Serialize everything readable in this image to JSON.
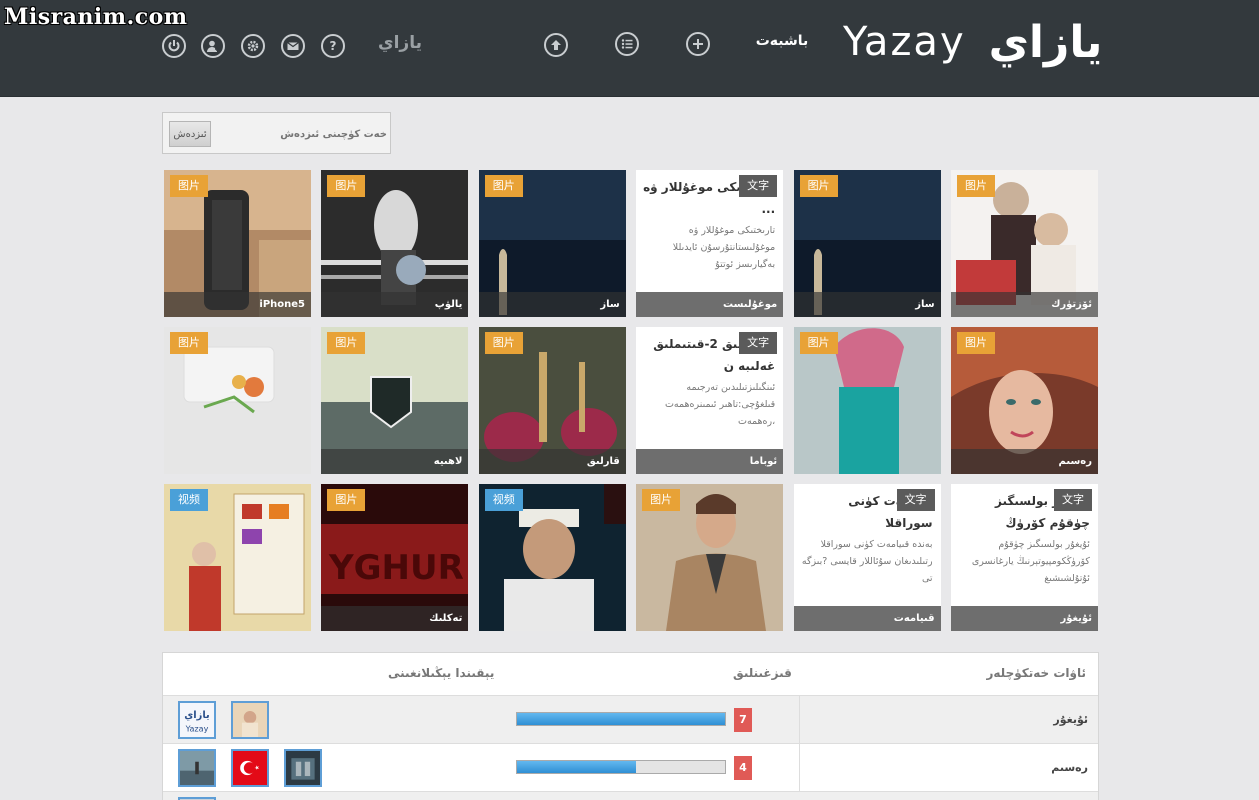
{
  "watermark": "Misranim.com",
  "header": {
    "user_label": "يازاي",
    "home_label": "باشبەت",
    "logo_latin": "Yazay",
    "logo_arabic": "يازاي"
  },
  "search": {
    "button_label": "ئىزدەش",
    "placeholder": "خەت كۈچىنى ئىزدەش"
  },
  "tiles": [
    {
      "type": "image",
      "badge": "图片",
      "caption": "iPhone5"
    },
    {
      "type": "image",
      "badge": "图片",
      "caption": "يالۋپ"
    },
    {
      "type": "image",
      "badge": "图片",
      "caption": "ساز"
    },
    {
      "type": "text",
      "badge": "文字",
      "title": "تارىختىكى موغۇللار ۋە ...",
      "body": "تارىختىكى موغۇللار ۋە موغۇلىستانتۇرسۇن ئايدىللا بەگيارىسز ئوتتۇ",
      "caption": "موغۇلىست"
    },
    {
      "type": "image",
      "badge": "图片",
      "caption": "ساز"
    },
    {
      "type": "image",
      "badge": "图片",
      "caption": "ئۆزتۈرك"
    },
    {
      "type": "image",
      "badge": "图片",
      "caption": ""
    },
    {
      "type": "image",
      "badge": "图片",
      "caption": "لاھىيە"
    },
    {
      "type": "image",
      "badge": "图片",
      "caption": "قارلىق"
    },
    {
      "type": "text",
      "badge": "文字",
      "title": "ئوبامالىق 2-قىتىملىق غەلىبە ن",
      "body": "ئىنگىلىزتىلىدىن تەرجىمە قىلغۇچى:تاھىر ئىمىنرەھمەت ،رەھمەت",
      "caption": "ئوباما"
    },
    {
      "type": "image",
      "badge": "图片",
      "caption": ""
    },
    {
      "type": "image",
      "badge": "图片",
      "caption": "رەسىم"
    },
    {
      "type": "image",
      "badge": "视频",
      "caption": ""
    },
    {
      "type": "image",
      "badge": "图片",
      "caption": "تەكلىك"
    },
    {
      "type": "image",
      "badge": "视频",
      "caption": ""
    },
    {
      "type": "image",
      "badge": "图片",
      "caption": ""
    },
    {
      "type": "text",
      "badge": "文字",
      "title": "قىيامەت كۈنى سوراقلا",
      "body": "بەندە قىيامەت كۈنى سوراقلا رتىلىدىغان سۇئاللار قايسى ?بىزگە تى",
      "caption": "قىيامەت"
    },
    {
      "type": "text",
      "badge": "文字",
      "title": "ئۇيغۇر بولسىگىز چۈقۇم كۆرۈڭ",
      "body": "ئۇيغۇر بولسىگىز چۈقۇم كۆرۈڭكومپيوتېرنىڭ يارغانسرى ئۇتۇلشىشىغ",
      "caption": "ئۇيغۇر"
    }
  ],
  "table": {
    "col_tags": "ئاۋات خەتكۈچلەر",
    "col_popularity": "قىزغىنلىق",
    "col_recent": "يېقىندا يېڭىلانغىنى",
    "rows": [
      {
        "label": "ئۇيغۇر",
        "count": "7",
        "percent": 100,
        "avatars": [
          "thumb-a",
          "thumb-b"
        ]
      },
      {
        "label": "رەسىم",
        "count": "4",
        "percent": 57,
        "avatars": [
          "thumb-c",
          "thumb-d",
          "thumb-e"
        ]
      },
      {
        "label": "",
        "count": "",
        "percent": 0,
        "avatars": [
          "thumb-f"
        ]
      }
    ]
  },
  "colors": {
    "header_bg": "#33393d",
    "badge_image": "#e8a236",
    "badge_text": "#5b5b5b",
    "badge_video": "#4aa0d8",
    "bar_fill": "#2f8fd4",
    "count_bg": "#e05a56"
  },
  "icons": [
    "power-icon",
    "user-add-icon",
    "gear-icon",
    "mail-icon",
    "help-icon",
    "upload-icon",
    "list-icon",
    "plus-icon"
  ]
}
